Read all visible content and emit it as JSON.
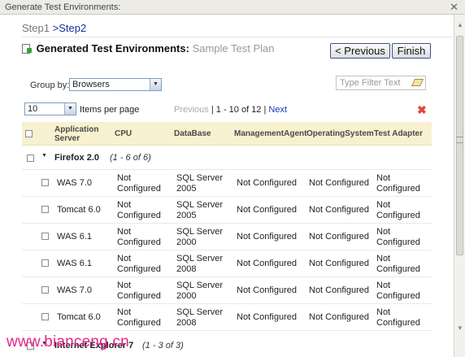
{
  "window": {
    "title": "Generate Test Environments:",
    "close_glyph": "✕"
  },
  "steps": {
    "step1": "Step1",
    "sep": " >",
    "step2": "Step2"
  },
  "heading": {
    "main": "Generated Test Environments:",
    "sub": "Sample Test Plan"
  },
  "buttons": {
    "previous": "< Previous",
    "finish": "Finish"
  },
  "groupby": {
    "label": "Group by:",
    "value": "Browsers"
  },
  "filter": {
    "placeholder": "Type Filter Text"
  },
  "paging": {
    "per_page_value": "10",
    "per_page_label": "Items per page",
    "previous": "Previous",
    "range": " | 1 - 10 of 12 | ",
    "next": "Next"
  },
  "columns": [
    "Application Server",
    "CPU",
    "DataBase",
    "ManagementAgent",
    "OperatingSystem",
    "Test Adapter"
  ],
  "group": {
    "name": "Firefox 2.0",
    "count": "(1 - 6 of 6)"
  },
  "rows": [
    {
      "app": "WAS 7.0",
      "cpu": "Not Configured",
      "db": "SQL Server 2005",
      "agent": "Not Configured",
      "os": "Not Configured",
      "adapter": "Not Configured"
    },
    {
      "app": "Tomcat 6.0",
      "cpu": "Not Configured",
      "db": "SQL Server 2005",
      "agent": "Not Configured",
      "os": "Not Configured",
      "adapter": "Not Configured"
    },
    {
      "app": "WAS 6.1",
      "cpu": "Not Configured",
      "db": "SQL Server 2000",
      "agent": "Not Configured",
      "os": "Not Configured",
      "adapter": "Not Configured"
    },
    {
      "app": "WAS 6.1",
      "cpu": "Not Configured",
      "db": "SQL Server 2008",
      "agent": "Not Configured",
      "os": "Not Configured",
      "adapter": "Not Configured"
    },
    {
      "app": "WAS 7.0",
      "cpu": "Not Configured",
      "db": "SQL Server 2000",
      "agent": "Not Configured",
      "os": "Not Configured",
      "adapter": "Not Configured"
    },
    {
      "app": "Tomcat 6.0",
      "cpu": "Not Configured",
      "db": "SQL Server 2008",
      "agent": "Not Configured",
      "os": "Not Configured",
      "adapter": "Not Configured"
    }
  ],
  "group2": {
    "name": "Internet Explorer 7",
    "count": "(1 - 3 of 3)"
  },
  "watermark": "www.bianceng.cn",
  "colors": {
    "header_bg": "#f7f1d0",
    "link": "#1a39b8",
    "watermark": "#e5238a",
    "delete": "#e04a3a"
  }
}
